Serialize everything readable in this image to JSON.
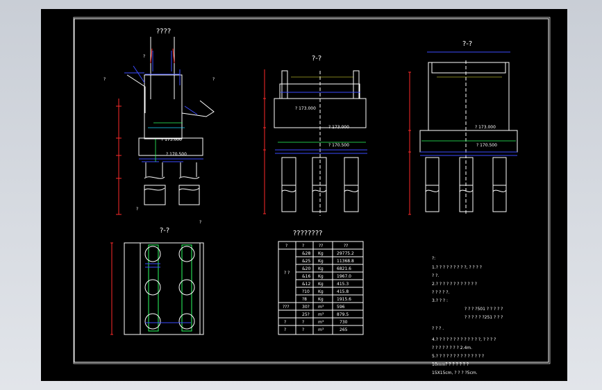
{
  "colors": {
    "background": "#000000",
    "line": "#ffffff",
    "dim": "#ff2a2a",
    "cyan": "#18d8ff",
    "blue": "#3c4cff",
    "green": "#2cff62",
    "yellow": "#ffff38"
  },
  "titles": {
    "elevation_main": "????",
    "section_a": "?-?",
    "section_b": "?-?",
    "plan": "?-?",
    "table_title": "????????"
  },
  "labels": {
    "left_cut": "?",
    "right_cut": "?",
    "pile_note": "?",
    "elev_a": "? 173.000",
    "elev_b": "? 170.500",
    "elev_c": "? 173.000",
    "elev_d": "? 170.500"
  },
  "table": {
    "headers": [
      "?",
      "?",
      "??",
      "??"
    ],
    "rows": [
      [
        "?  ?",
        "&28",
        "Kg",
        "29775.2"
      ],
      [
        "",
        "&25",
        "Kg",
        "11368.8"
      ],
      [
        "",
        "&20",
        "Kg",
        "6821.6"
      ],
      [
        "",
        "&16",
        "Kg",
        "1967.0"
      ],
      [
        "",
        "&12",
        "Kg",
        "415.3"
      ],
      [
        "",
        "?10",
        "Kg",
        "415.8"
      ],
      [
        "",
        "?8",
        "Kg",
        "1915.6"
      ],
      [
        "???",
        "30?",
        "m³",
        "596"
      ],
      [
        "",
        "25?",
        "m³",
        "879.5"
      ],
      [
        "?",
        "?",
        "m³",
        "730"
      ],
      [
        "?",
        "?",
        "m³",
        "265"
      ]
    ]
  },
  "notes": [
    "?:",
    "1.? ? ? ? ?  ?  ?  ?  ?,  ? ? ? ?",
    "? ?.",
    "2.? ? ? ? ? ?   ? ? ? ? ? ?",
    "? ? ? ? ?.",
    "3.? ? ? :",
    "? ? ?  ?501 ? ? ? ? ?",
    "? ? ? ? ?  ?251 ? ? ?",
    "? ? ? .",
    "4.? ? ? ? ? ?  ? ? ? ? ? ? ?,  ? ? ? ?",
    "? ? ? ? ? ? ? ? 2.4m.",
    "5.? ? ? ? ? ?  ? ? ? ? ? ? ?  ?",
    "10mm? ? ? ? ? ? ?",
    "15X15cm, ? ?  ? ?5cm."
  ]
}
